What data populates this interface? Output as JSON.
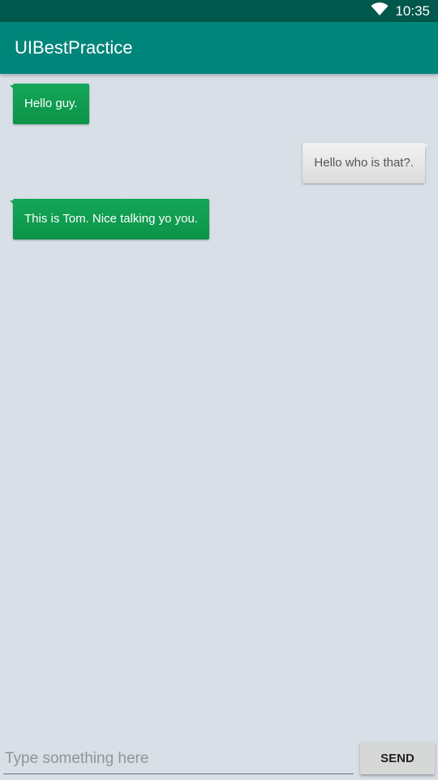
{
  "status_bar": {
    "time": "10:35",
    "wifi_icon": "wifi-icon"
  },
  "app_bar": {
    "title": "UIBestPractice"
  },
  "messages": [
    {
      "side": "left",
      "text": "Hello guy."
    },
    {
      "side": "right",
      "text": "Hello who is that?."
    },
    {
      "side": "left",
      "text": "This is Tom. Nice talking yo you."
    }
  ],
  "composer": {
    "input_value": "",
    "input_placeholder": "Type something here",
    "send_label": "SEND"
  },
  "colors": {
    "status_bar": "#00574b",
    "app_bar": "#00857a",
    "background": "#d8dfe7",
    "received_bubble": "#0f9d50",
    "sent_bubble": "#e6e6e6"
  }
}
